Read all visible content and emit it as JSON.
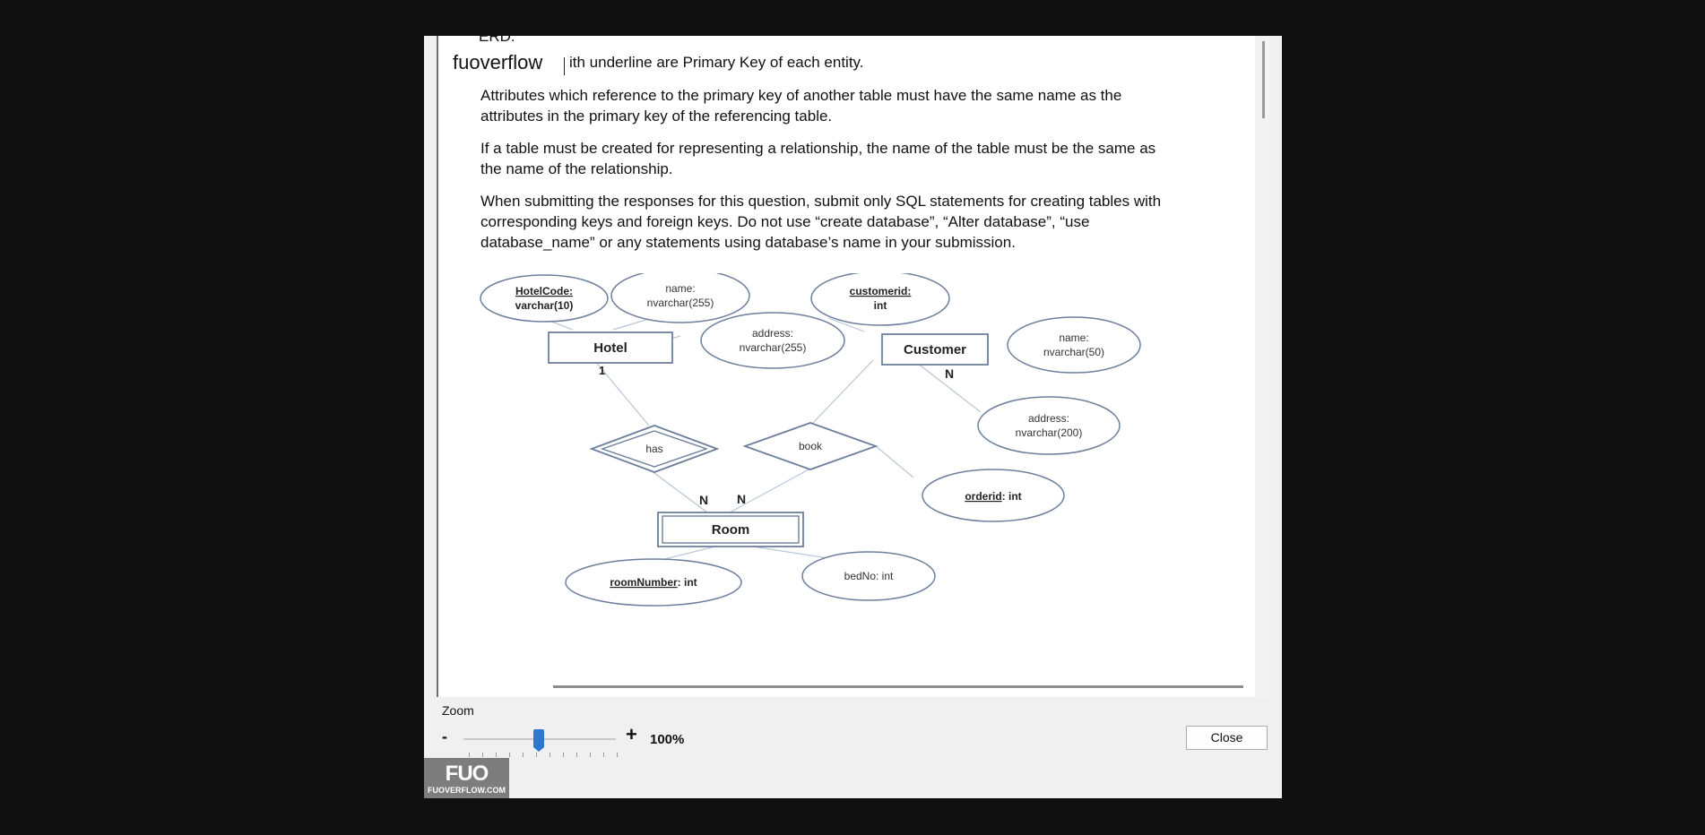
{
  "document": {
    "cut_top_text": "ERD:",
    "watermark_label": "fuoverflow",
    "line1": "ith underline are Primary Key of each entity.",
    "paragraphs": [
      "Attributes which reference to the primary key of another table must have the same name as the attributes in the primary key of the referencing table.",
      "If a table must be created for representing a relationship, the name of the table must be the same as the name of the relationship.",
      "When submitting the responses for this question, submit only SQL statements for creating tables with corresponding keys and foreign keys. Do not use “create database”, “Alter database”, “use database_name” or any statements using database’s name in your submission."
    ]
  },
  "erd": {
    "entities": {
      "hotel": "Hotel",
      "customer": "Customer",
      "room": "Room"
    },
    "relationships": {
      "has": "has",
      "book": "book"
    },
    "attributes": {
      "hotel_code_key": "HotelCode:",
      "hotel_code_type": "varchar(10)",
      "hotel_name_1": "name:",
      "hotel_name_2": "nvarchar(255)",
      "hotel_address_1": "address:",
      "hotel_address_2": "nvarchar(255)",
      "customer_id_key": "customerid:",
      "customer_id_type": "int",
      "customer_name_1": "name:",
      "customer_name_2": "nvarchar(50)",
      "customer_address_1": "address:",
      "customer_address_2": "nvarchar(200)",
      "orderid_key": "orderid",
      "orderid_type": ": int",
      "roomnumber_key": "roomNumber",
      "roomnumber_type": ": int",
      "bedno": "bedNo: int"
    },
    "cardinalities": {
      "hotel_has": "1",
      "customer_book": "N",
      "room_has": "N",
      "room_book": "N"
    }
  },
  "zoom": {
    "label": "Zoom",
    "minus": "-",
    "plus": "+",
    "value": "100%",
    "slider_fraction": 0.5
  },
  "close_button": "Close",
  "logo": {
    "mark": "FUO",
    "text": "FUOVERFLOW.COM"
  }
}
